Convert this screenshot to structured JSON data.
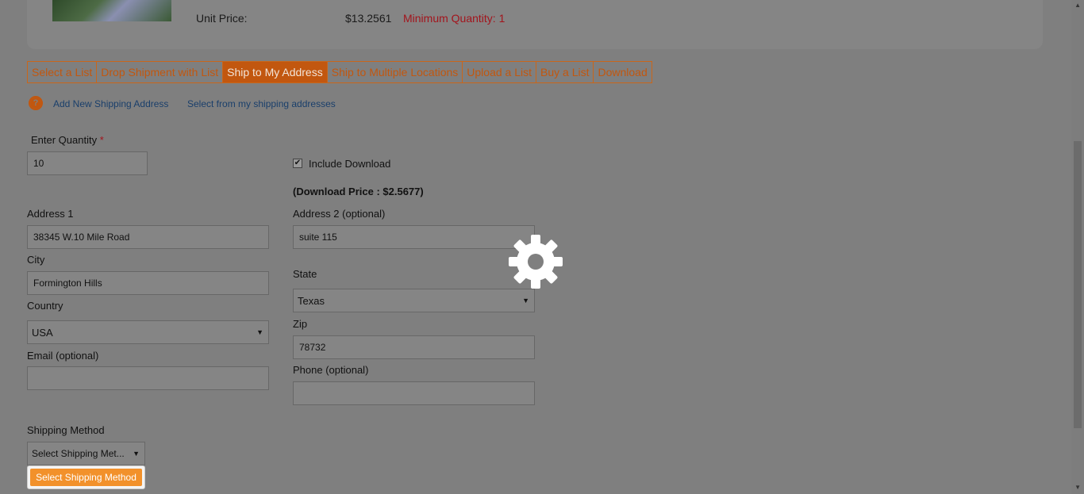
{
  "product": {
    "unit_price_label": "Unit Price:",
    "unit_price": "$13.2561",
    "minimum_quantity": "Minimum Quantity: 1"
  },
  "tabs": [
    {
      "label": "Select a List",
      "active": false
    },
    {
      "label": "Drop Shipment with List",
      "active": false
    },
    {
      "label": "Ship to My Address",
      "active": true
    },
    {
      "label": "Ship to Multiple Locations",
      "active": false
    },
    {
      "label": "Upload a List",
      "active": false
    },
    {
      "label": "Buy a List",
      "active": false
    },
    {
      "label": "Download",
      "active": false
    }
  ],
  "links": {
    "add_new": "Add New Shipping Address",
    "select_from": "Select from my shipping addresses"
  },
  "form": {
    "quantity_label": "Enter Quantity",
    "required_marker": "*",
    "quantity_value": "10",
    "include_download_label": "Include Download",
    "include_download_checked": true,
    "download_price": "(Download Price : $2.5677)",
    "address1_label": "Address 1",
    "address1_value": "38345 W.10 Mile Road",
    "address2_label": "Address 2 (optional)",
    "address2_value": "suite 115",
    "city_label": "City",
    "city_value": "Formington Hills",
    "state_label": "State",
    "state_value": "Texas",
    "country_label": "Country",
    "country_value": "USA",
    "zip_label": "Zip",
    "zip_value": "78732",
    "email_label": "Email (optional)",
    "email_value": "",
    "phone_label": "Phone (optional)",
    "phone_value": "",
    "shipping_method_label": "Shipping Method",
    "shipping_method_value": "Select Shipping Met...",
    "shipping_method_option": "Select Shipping Method"
  },
  "overlay": {
    "icon": "gear-icon"
  },
  "colors": {
    "accent": "#c2570f",
    "required": "#a3141c",
    "button": "#f2912b",
    "overlay_bg": "#7f7f7f"
  }
}
